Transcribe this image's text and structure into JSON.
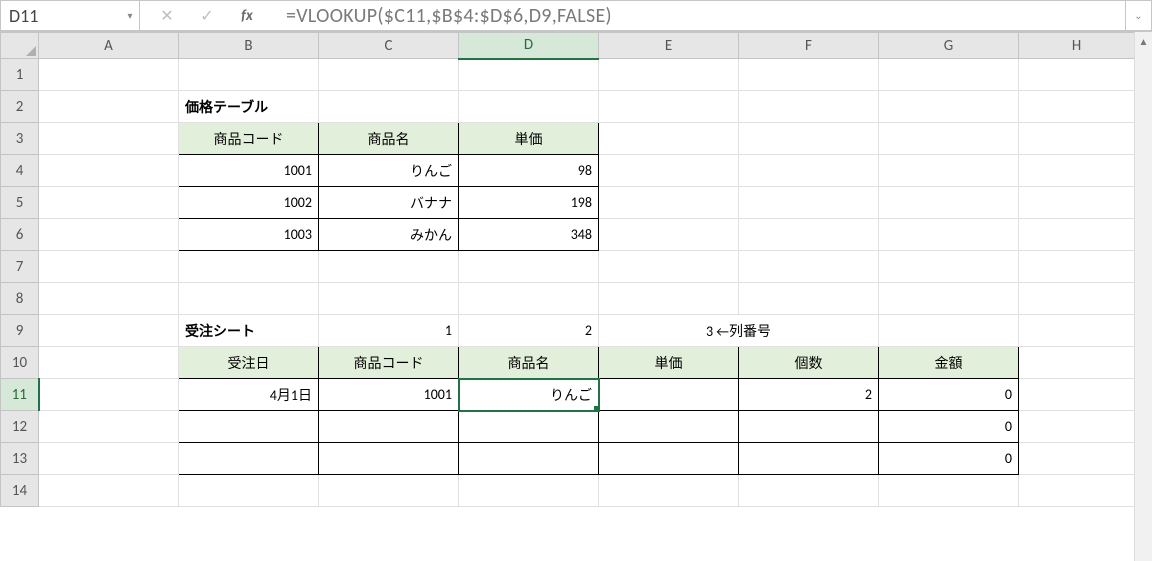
{
  "namebox": {
    "ref": "D11"
  },
  "formula_bar": {
    "formula": "=VLOOKUP($C11,$B$4:$D$6,D9,FALSE)",
    "fx_label": "fx"
  },
  "columns": [
    "A",
    "B",
    "C",
    "D",
    "E",
    "F",
    "G",
    "H"
  ],
  "rows": [
    "1",
    "2",
    "3",
    "4",
    "5",
    "6",
    "7",
    "8",
    "9",
    "10",
    "11",
    "12",
    "13",
    "14"
  ],
  "selected": {
    "col": "D",
    "row": "11"
  },
  "cells": {
    "B2": "価格テーブル",
    "B3": "商品コード",
    "C3": "商品名",
    "D3": "単価",
    "B4": "1001",
    "C4": "りんご",
    "D4": "98",
    "B5": "1002",
    "C5": "バナナ",
    "D5": "198",
    "B6": "1003",
    "C6": "みかん",
    "D6": "348",
    "B9": "受注シート",
    "C9": "1",
    "D9": "2",
    "E9_F9": "3 ←列番号",
    "B10": "受注日",
    "C10": "商品コード",
    "D10": "商品名",
    "E10": "単価",
    "F10": "個数",
    "G10": "金額",
    "B11": "4月1日",
    "C11": "1001",
    "D11": "りんご",
    "F11": "2",
    "G11": "0",
    "G12": "0",
    "G13": "0"
  },
  "col_widths": {
    "rowhead": 38,
    "A": 140,
    "B": 140,
    "C": 140,
    "D": 140,
    "E": 140,
    "F": 140,
    "G": 140,
    "H": 120
  }
}
